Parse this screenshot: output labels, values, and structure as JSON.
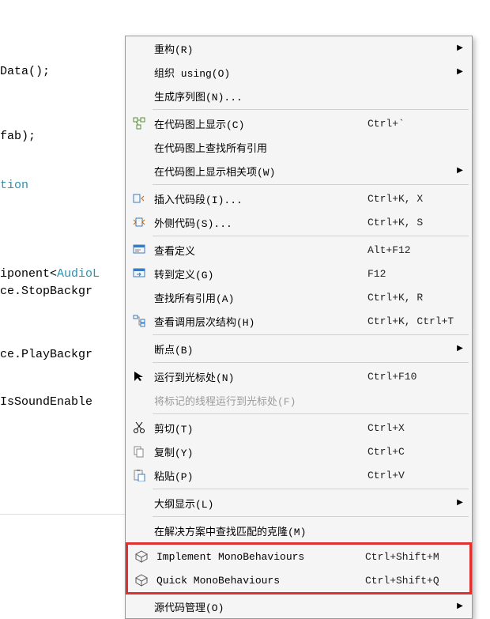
{
  "code": {
    "line1": "Data();",
    "line2": "fab);",
    "line3": "tion",
    "line4a": "iponent<",
    "line4b": "AudioL",
    "line5": "ce.StopBackgr",
    "line6": "ce.PlayBackgr",
    "line7": "IsSoundEnable"
  },
  "menu": {
    "items": [
      {
        "id": "refactor",
        "icon": "",
        "label": "重构(R)",
        "shortcut": "",
        "sub": true
      },
      {
        "id": "organize-using",
        "icon": "",
        "label": "组织 using(O)",
        "shortcut": "",
        "sub": true
      },
      {
        "id": "gen-seq",
        "icon": "",
        "label": "生成序列图(N)...",
        "shortcut": "",
        "sub": false
      },
      {
        "sep": true
      },
      {
        "id": "show-codemap",
        "icon": "codemap",
        "label": "在代码图上显示(C)",
        "shortcut": "Ctrl+`",
        "sub": false
      },
      {
        "id": "find-refs-codemap",
        "icon": "",
        "label": "在代码图上查找所有引用",
        "shortcut": "",
        "sub": false
      },
      {
        "id": "show-related-codemap",
        "icon": "",
        "label": "在代码图上显示相关项(W)",
        "shortcut": "",
        "sub": true
      },
      {
        "sep": true
      },
      {
        "id": "insert-snippet",
        "icon": "snippet-in",
        "label": "插入代码段(I)...",
        "shortcut": "Ctrl+K, X",
        "sub": false
      },
      {
        "id": "surround-snippet",
        "icon": "snippet-out",
        "label": "外侧代码(S)...",
        "shortcut": "Ctrl+K, S",
        "sub": false
      },
      {
        "sep": true
      },
      {
        "id": "peek-def",
        "icon": "peek",
        "label": "查看定义",
        "shortcut": "Alt+F12",
        "sub": false
      },
      {
        "id": "goto-def",
        "icon": "goto",
        "label": "转到定义(G)",
        "shortcut": "F12",
        "sub": false
      },
      {
        "id": "find-all-refs",
        "icon": "",
        "label": "查找所有引用(A)",
        "shortcut": "Ctrl+K, R",
        "sub": false
      },
      {
        "id": "call-hierarchy",
        "icon": "hierarchy",
        "label": "查看调用层次结构(H)",
        "shortcut": "Ctrl+K, Ctrl+T",
        "sub": false
      },
      {
        "sep": true
      },
      {
        "id": "breakpoints",
        "icon": "",
        "label": "断点(B)",
        "shortcut": "",
        "sub": true
      },
      {
        "sep": true
      },
      {
        "id": "run-to-cursor",
        "icon": "cursor",
        "label": "运行到光标处(N)",
        "shortcut": "Ctrl+F10",
        "sub": false
      },
      {
        "id": "run-flagged",
        "icon": "",
        "label": "将标记的线程运行到光标处(F)",
        "shortcut": "",
        "sub": false,
        "disabled": true
      },
      {
        "sep": true
      },
      {
        "id": "cut",
        "icon": "cut",
        "label": "剪切(T)",
        "shortcut": "Ctrl+X",
        "sub": false
      },
      {
        "id": "copy",
        "icon": "copy",
        "label": "复制(Y)",
        "shortcut": "Ctrl+C",
        "sub": false
      },
      {
        "id": "paste",
        "icon": "paste",
        "label": "粘贴(P)",
        "shortcut": "Ctrl+V",
        "sub": false
      },
      {
        "sep": true
      },
      {
        "id": "outline",
        "icon": "",
        "label": "大纲显示(L)",
        "shortcut": "",
        "sub": true
      },
      {
        "sep": true
      },
      {
        "id": "find-clones",
        "icon": "",
        "label": "在解决方案中查找匹配的克隆(M)",
        "shortcut": "",
        "sub": false
      },
      {
        "hl_start": true
      },
      {
        "id": "impl-mono",
        "icon": "cube",
        "label": "Implement MonoBehaviours",
        "shortcut": "Ctrl+Shift+M",
        "sub": false
      },
      {
        "id": "quick-mono",
        "icon": "cube",
        "label": "Quick MonoBehaviours",
        "shortcut": "Ctrl+Shift+Q",
        "sub": false
      },
      {
        "hl_end": true
      },
      {
        "id": "source-control",
        "icon": "",
        "label": "源代码管理(O)",
        "shortcut": "",
        "sub": true
      }
    ]
  }
}
